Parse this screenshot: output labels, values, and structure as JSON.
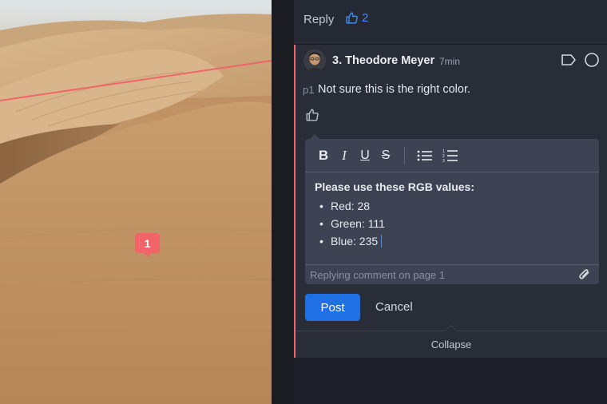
{
  "canvas": {
    "pin_number": "1",
    "image_name": "desert-dunes-photo"
  },
  "header": {
    "reply_label": "Reply",
    "like_count": "2"
  },
  "comment": {
    "index": "3.",
    "author": "Theodore Meyer",
    "time": "7min",
    "page_ref": "p1",
    "text": "Not sure this is the right color."
  },
  "editor": {
    "toolbar": {
      "bold": "B",
      "italic": "I",
      "underline": "U",
      "strike": "S"
    },
    "lead": "Please use these RGB values:",
    "items": [
      "Red: 28",
      "Green: 111",
      "Blue: 235"
    ],
    "footer": "Replying comment on page 1"
  },
  "actions": {
    "post": "Post",
    "cancel": "Cancel",
    "collapse": "Collapse"
  },
  "colors": {
    "accent": "#1f6fe5",
    "link_blue": "#3e8cf0",
    "annotation_red": "#f0646a",
    "panel_bg": "#292d38"
  },
  "icons": {
    "like": "thumbs-up-icon",
    "tag": "tag-icon",
    "resolve": "circle-icon",
    "bullet_list": "bullet-list-icon",
    "numbered_list": "numbered-list-icon",
    "attach": "paperclip-icon"
  }
}
